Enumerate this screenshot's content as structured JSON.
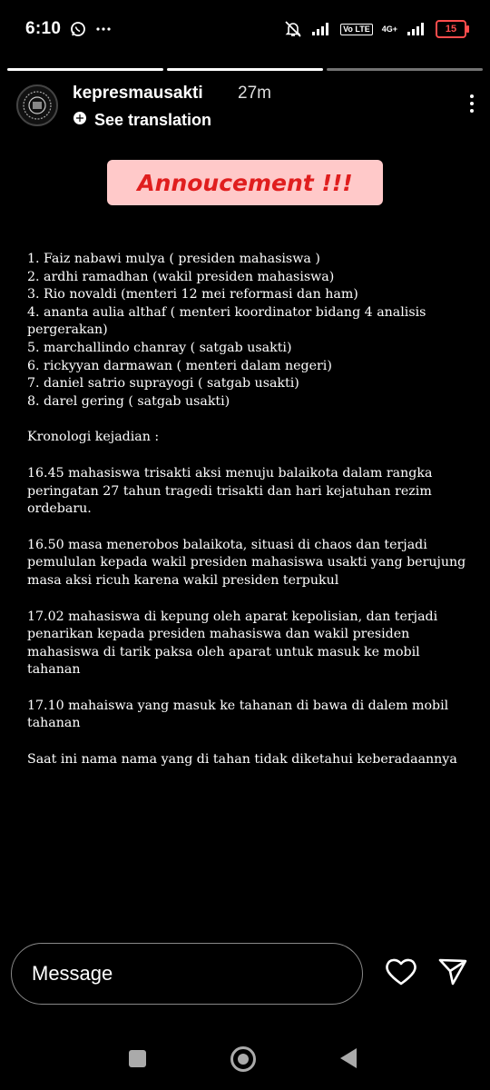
{
  "status_bar": {
    "time": "6:10",
    "battery": "15",
    "network": "4G+",
    "volte": "Vo LTE"
  },
  "story": {
    "segments_total": 3,
    "segments_done": 2,
    "username": "kepresmausakti",
    "time_ago": "27m",
    "translate_label": "See translation"
  },
  "announcement": "Annoucement !!!",
  "names": [
    "1. Faiz nabawi mulya ( presiden mahasiswa )",
    "2. ardhi ramadhan (wakil presiden mahasiswa)",
    "3. Rio novaldi (menteri 12 mei reformasi dan ham)",
    "4. ananta aulia althaf ( menteri koordinator bidang 4 analisis pergerakan)",
    "5. marchallindo chanray ( satgab usakti)",
    "6. rickyyan darmawan ( menteri dalam negeri)",
    "7. daniel satrio suprayogi ( satgab usakti)",
    "8. darel gering ( satgab usakti)"
  ],
  "kronologi_title": "Kronologi kejadian :",
  "kronologi": [
    "16.45 mahasiswa trisakti aksi menuju balaikota dalam rangka peringatan 27 tahun tragedi trisakti dan hari kejatuhan rezim ordebaru.",
    "16.50 masa menerobos balaikota, situasi di chaos dan terjadi pemululan kepada wakil presiden mahasiswa usakti yang berujung masa aksi ricuh karena wakil presiden terpukul",
    "17.02 mahasiswa di kepung oleh aparat kepolisian, dan terjadi penarikan kepada presiden mahasiswa dan wakil presiden mahasiswa di tarik paksa oleh aparat untuk masuk ke mobil tahanan",
    "17.10 mahaiswa yang masuk ke tahanan di bawa di dalem mobil tahanan"
  ],
  "closing": "Saat ini nama nama yang di tahan tidak diketahui keberadaannya",
  "message_bar": {
    "placeholder": "Message"
  },
  "colors": {
    "background": "#000000",
    "announcement_bg": "#ffc9c9",
    "announcement_text": "#e01e1e",
    "battery_low": "#ff4d4d"
  }
}
